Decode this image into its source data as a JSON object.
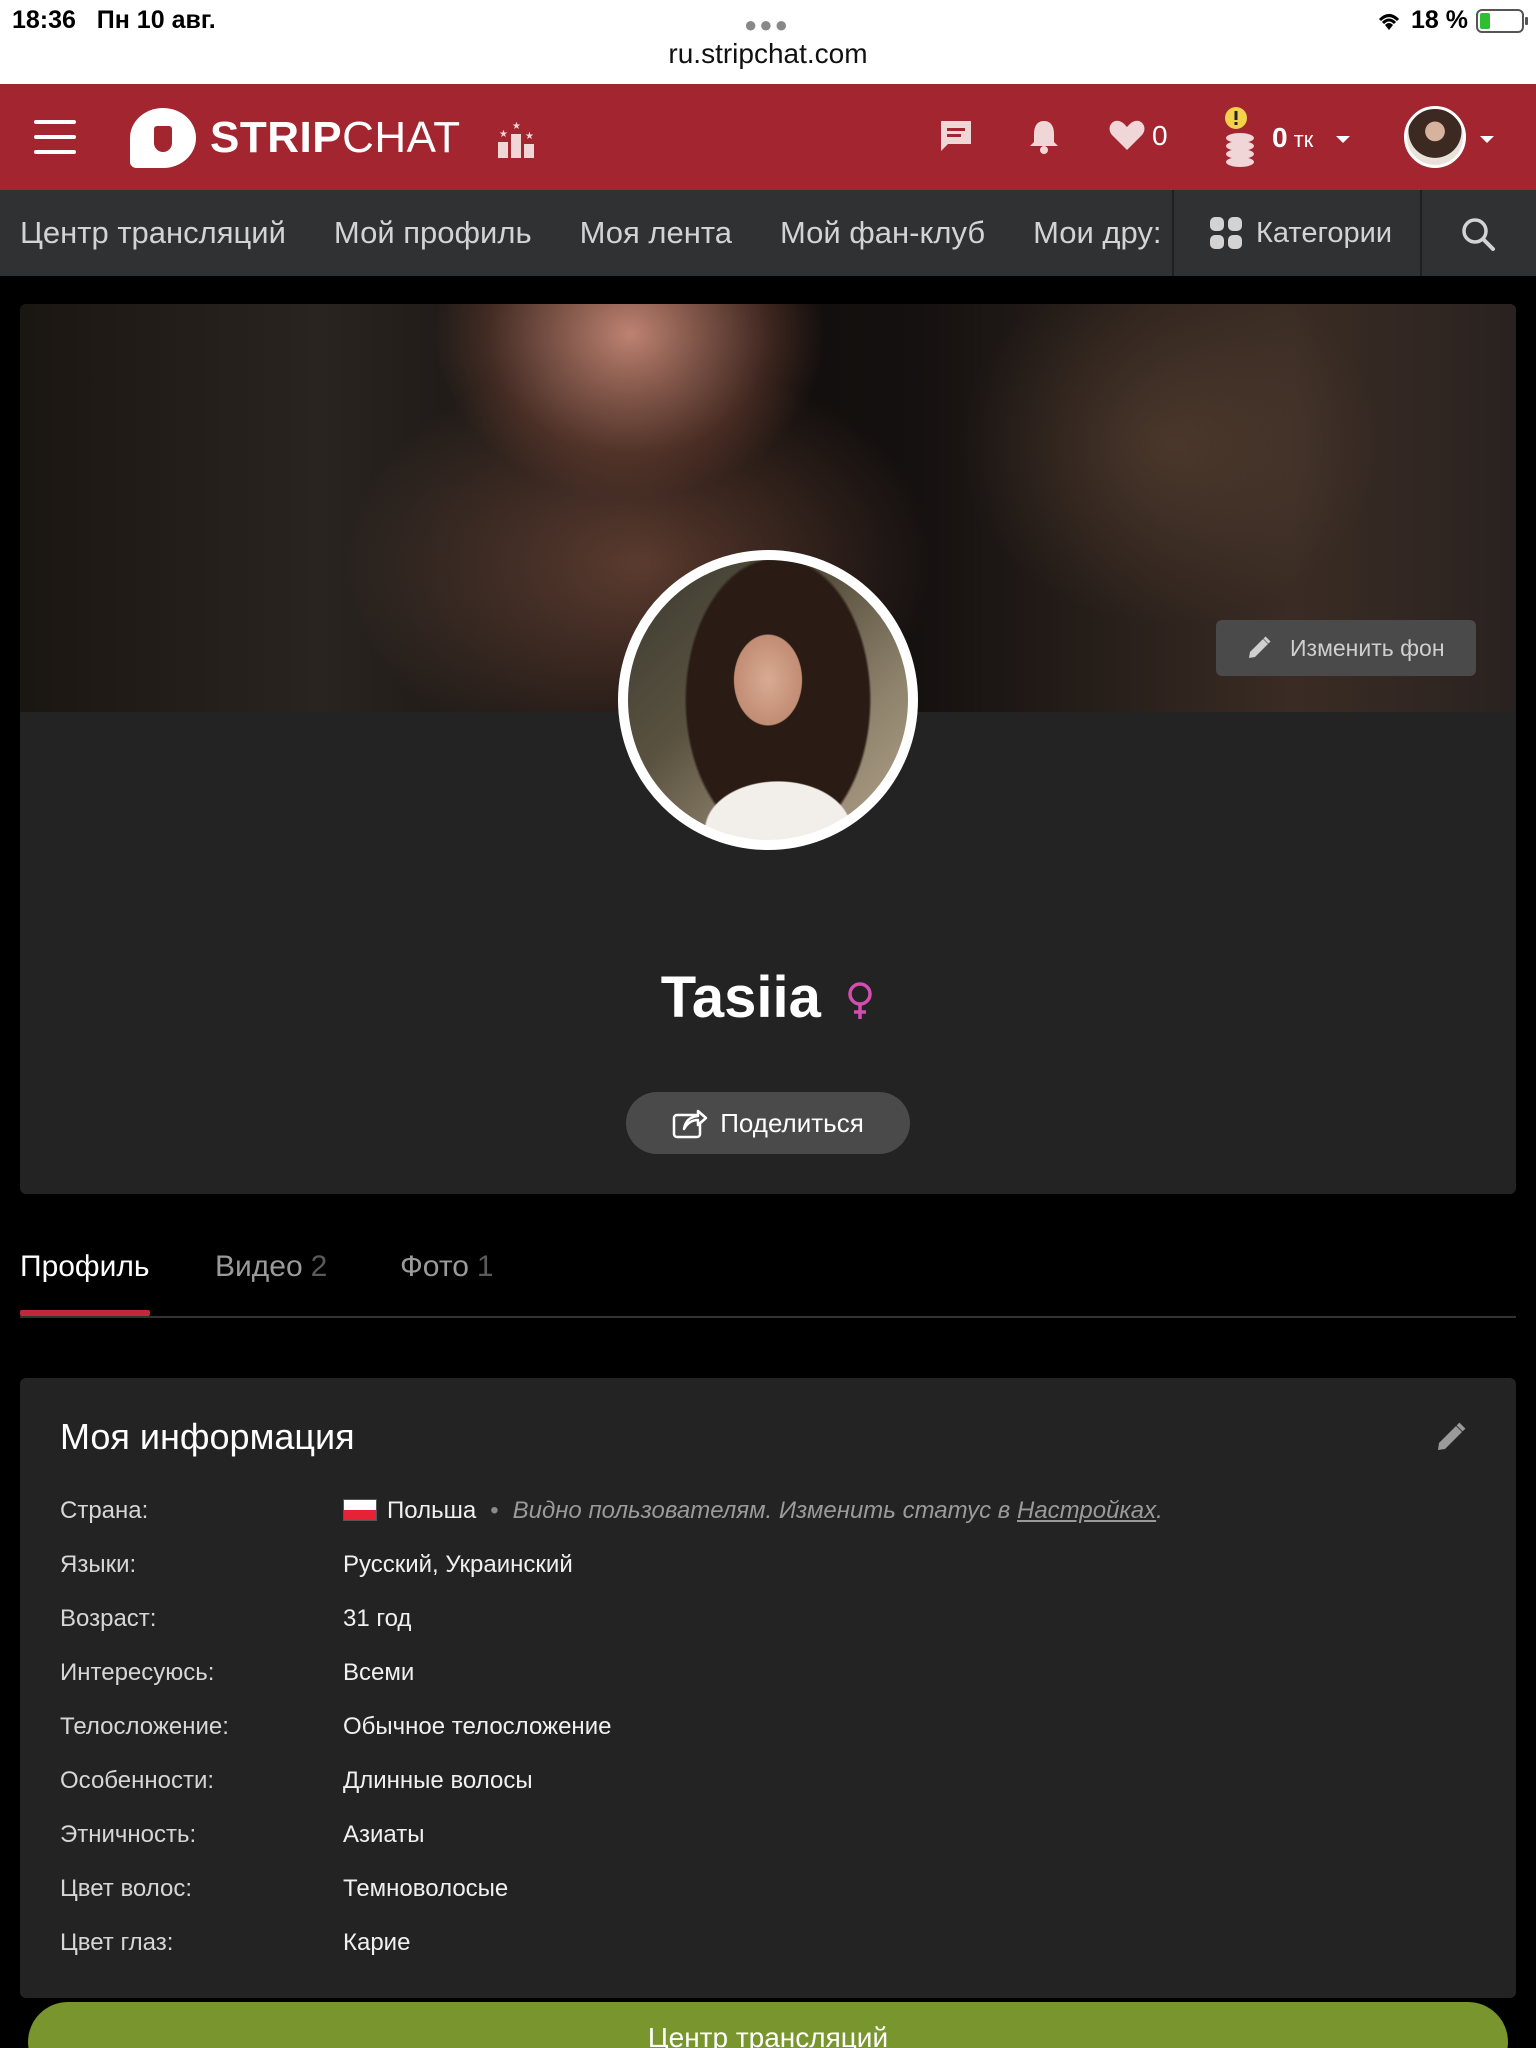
{
  "status_bar": {
    "time": "18:36",
    "date": "Пн 10 авг.",
    "url": "ru.stripchat.com",
    "battery": "18 %"
  },
  "header": {
    "logo_bold": "STRIP",
    "logo_light": "CHAT",
    "favorites_count": "0",
    "tokens_value": "0",
    "tokens_unit": "тк",
    "accent_color": "#a2252f"
  },
  "nav": {
    "items": [
      {
        "label": "Центр трансляций"
      },
      {
        "label": "Мой профиль"
      },
      {
        "label": "Моя лента"
      },
      {
        "label": "Мой фан-клуб"
      },
      {
        "label": "Мои дру:"
      }
    ],
    "categories_label": "Категории"
  },
  "profile": {
    "change_bg_label": "Изменить фон",
    "username": "Tasiia",
    "share_label": "Поделиться"
  },
  "tabs": [
    {
      "label": "Профиль",
      "count": ""
    },
    {
      "label": "Видео",
      "count": "2"
    },
    {
      "label": "Фото",
      "count": "1"
    }
  ],
  "info": {
    "title": "Моя информация",
    "rows": [
      {
        "label": "Страна:",
        "value": "Польша"
      },
      {
        "label": "Языки:",
        "value": "Русский, Украинский"
      },
      {
        "label": "Возраст:",
        "value": "31 год"
      },
      {
        "label": "Интересуюсь:",
        "value": "Всеми"
      },
      {
        "label": "Телосложение:",
        "value": "Обычное телосложение"
      },
      {
        "label": "Особенности:",
        "value": "Длинные волосы"
      },
      {
        "label": "Этничность:",
        "value": "Азиаты"
      },
      {
        "label": "Цвет волос:",
        "value": "Темноволосые"
      },
      {
        "label": "Цвет глаз:",
        "value": "Карие"
      }
    ],
    "visibility_text": "Видно пользователям. Изменить статус в",
    "settings_link": "Настройках",
    "period": "."
  },
  "bottom_button_label": "Центр трансляций"
}
